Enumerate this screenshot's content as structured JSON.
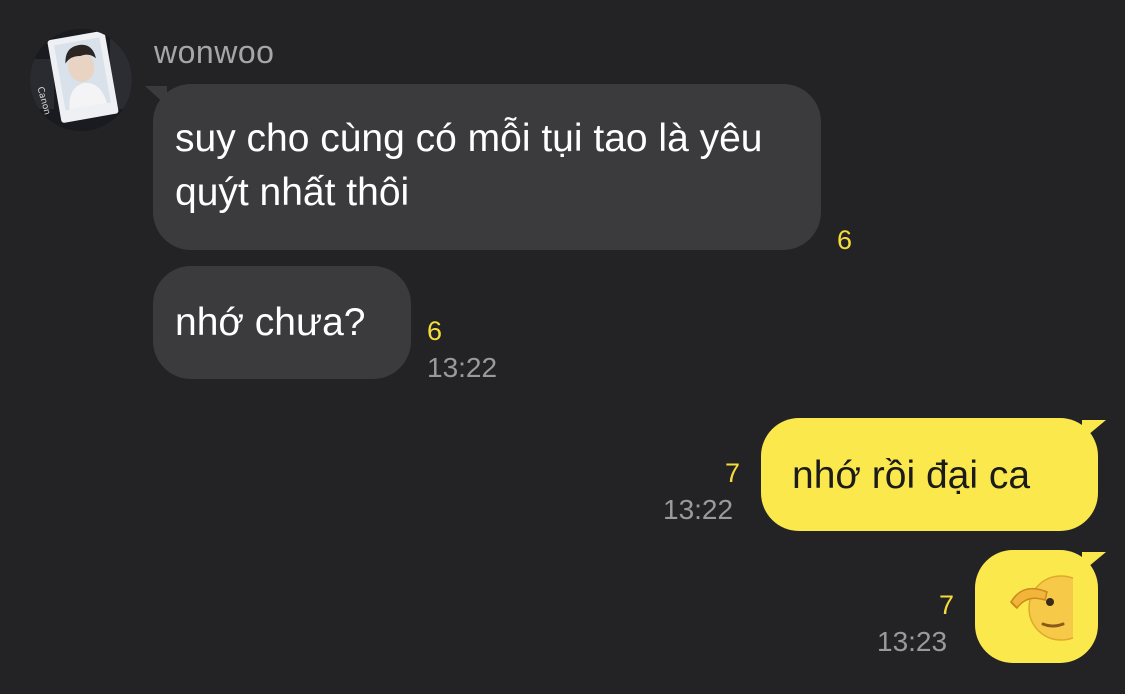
{
  "chat": {
    "sender": {
      "name": "wonwoo",
      "avatar": "profile-photo"
    },
    "messages": [
      {
        "direction": "incoming",
        "text": "suy cho cùng có mỗi tụi tao là yêu quýt nhất thôi",
        "unread": "6",
        "time": ""
      },
      {
        "direction": "incoming",
        "text": "nhớ chưa?",
        "unread": "6",
        "time": "13:22"
      },
      {
        "direction": "outgoing",
        "text": "nhớ rồi đại ca",
        "unread": "7",
        "time": "13:22"
      },
      {
        "direction": "outgoing",
        "emoji": "saluting-face",
        "unread": "7",
        "time": "13:23"
      }
    ]
  },
  "colors": {
    "background": "#232325",
    "incoming_bubble": "#3b3b3d",
    "outgoing_bubble": "#fbe84c",
    "unread_count": "#f5dc3c",
    "timestamp": "#9a9a9c",
    "sender_name": "#a6a6a8"
  }
}
